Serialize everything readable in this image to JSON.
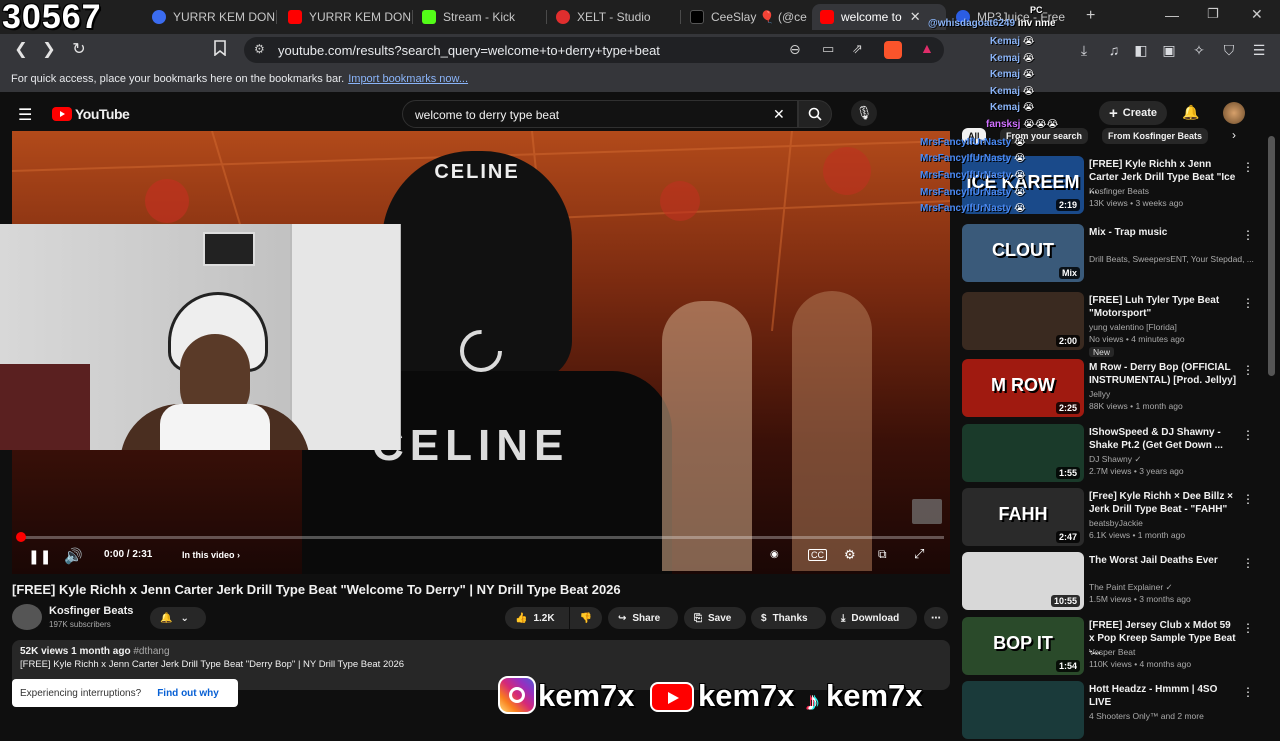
{
  "overlay_counter": "30567",
  "tabs": [
    {
      "label": "YURRR KEM DON",
      "color": "#3b6cf0"
    },
    {
      "label": "YURRR KEM DON",
      "color": "#ff0000"
    },
    {
      "label": "Stream - Kick",
      "color": "#53fc18"
    },
    {
      "label": "XELT - Studio",
      "color": "#e02e2e"
    },
    {
      "label": "CeeSlay 🎈 (@ce",
      "color": "#000000"
    },
    {
      "label": "welcome to",
      "color": "#ff0000"
    },
    {
      "label": "MP3Juice - Free",
      "color": "#2b5de3"
    }
  ],
  "address_bar": {
    "url": "youtube.com/results?search_query=welcome+to+derry+type+beat"
  },
  "bookmarks": {
    "text": "For quick access, place your bookmarks here on the bookmarks bar.",
    "link": "Import bookmarks now..."
  },
  "youtube": {
    "logo": "YouTube",
    "search_query": "welcome to derry type beat",
    "create_label": "Create"
  },
  "player": {
    "time": "0:00 / 2:31",
    "in_this_video": "In this video",
    "progress": 0.0
  },
  "video": {
    "title": "[FREE] Kyle Richh x Jenn Carter Jerk Drill Type Beat \"Welcome To Derry\" | NY Drill Type Beat 2026",
    "channel": "Kosfinger Beats",
    "subscribers": "197K subscribers",
    "likes": "1.2K",
    "share": "Share",
    "save": "Save",
    "thanks": "Thanks",
    "download": "Download",
    "views_line": "52K views  1 month ago",
    "hashtag": "#dthang",
    "description": "[FREE] Kyle Richh x Jenn Carter Jerk Drill Type Beat \"Derry Bop\" | NY Drill Type Beat 2026"
  },
  "toast": {
    "text": "Experiencing interruptions?",
    "link": "Find out why"
  },
  "chips": {
    "all": "All",
    "from_search": "From your search",
    "from_channel": "From Kosfinger Beats"
  },
  "recommendations": [
    {
      "title": "[FREE] Kyle Richh x Jenn Carter Jerk Drill Type Beat \"Ice ...",
      "channel": "Kosfinger Beats",
      "meta": "13K views • 3 weeks ago",
      "duration": "2:19",
      "thumb_text": "ICE KAREEM",
      "thumb_color": "#1a4a8a"
    },
    {
      "title": "Mix - Trap music",
      "channel": "Drill Beats, SweepersENT, Your Stepdad, ...",
      "meta": "",
      "duration": "Mix",
      "thumb_text": "CLOUT",
      "thumb_color": "#3a5a7a"
    },
    {
      "title": "[FREE] Luh Tyler Type Beat \"Motorsport\"",
      "channel": "yung valentino [Florida]",
      "meta": "No views • 4 minutes ago",
      "badge": "New",
      "duration": "2:00",
      "thumb_text": "",
      "thumb_color": "#3a2a20"
    },
    {
      "title": "M Row - Derry Bop (OFFICIAL INSTRUMENTAL) [Prod. Jellyy]",
      "channel": "Jellyy",
      "meta": "88K views • 1 month ago",
      "duration": "2:25",
      "thumb_text": "M ROW",
      "thumb_color": "#a01a10"
    },
    {
      "title": "IShowSpeed & DJ Shawny - Shake Pt.2 (Get Get Down ...",
      "channel": "DJ Shawny ✓",
      "meta": "2.7M views • 3 years ago",
      "duration": "1:55",
      "thumb_text": "",
      "thumb_color": "#1a3a2a"
    },
    {
      "title": "[Free] Kyle Richh × Dee Billz × Jerk Drill Type Beat - \"FAHH\"",
      "channel": "beatsbyJackie",
      "meta": "6.1K views • 1 month ago",
      "duration": "2:47",
      "thumb_text": "FAHH",
      "thumb_color": "#2a2a2a"
    },
    {
      "title": "The Worst Jail Deaths Ever",
      "channel": "The Paint Explainer ✓",
      "meta": "1.5M views • 3 months ago",
      "duration": "10:55",
      "thumb_text": "",
      "thumb_color": "#d8d8d8"
    },
    {
      "title": "[FREE] Jersey Club x Mdot 59 x Pop Kreep Sample Type Beat -...",
      "channel": "Vesper Beat",
      "meta": "110K views • 4 months ago",
      "duration": "1:54",
      "thumb_text": "BOP IT",
      "thumb_color": "#2a4a2a"
    },
    {
      "title": "Hott Headzz - Hmmm | 4SO LIVE",
      "channel": "4 Shooters Only™ and 2 more",
      "meta": "",
      "duration": "",
      "thumb_text": "",
      "thumb_color": "#1a3a3a"
    }
  ],
  "chat": [
    {
      "user": "@whisdagoat6249",
      "msg": "inv nme",
      "color": "#8ab4f8"
    },
    {
      "user": "Kemaj",
      "msg": "😭",
      "color": "#8ab4f8"
    },
    {
      "user": "Kemaj",
      "msg": "😭",
      "color": "#8ab4f8"
    },
    {
      "user": "Kemaj",
      "msg": "😭",
      "color": "#8ab4f8"
    },
    {
      "user": "Kemaj",
      "msg": "😭",
      "color": "#8ab4f8"
    },
    {
      "user": "Kemaj",
      "msg": "😭",
      "color": "#8ab4f8"
    },
    {
      "user": "fansksj",
      "msg": "😭😭😭",
      "color": "#d070ff"
    },
    {
      "user": "MrsFancyIfUrNasty",
      "msg": "😭",
      "color": "#4a8af4"
    },
    {
      "user": "MrsFancyIfUrNasty",
      "msg": "😭",
      "color": "#4a8af4"
    },
    {
      "user": "MrsFancyIfUrNasty",
      "msg": "😭",
      "color": "#4a8af4"
    },
    {
      "user": "MrsFancyIfUrNasty",
      "msg": "😭",
      "color": "#4a8af4"
    },
    {
      "user": "MrsFancyIfUrNasty",
      "msg": "😭",
      "color": "#4a8af4"
    }
  ],
  "chat_header": "PC",
  "socials": {
    "instagram": "kem7x",
    "youtube": "kem7x",
    "tiktok": "kem7x"
  }
}
